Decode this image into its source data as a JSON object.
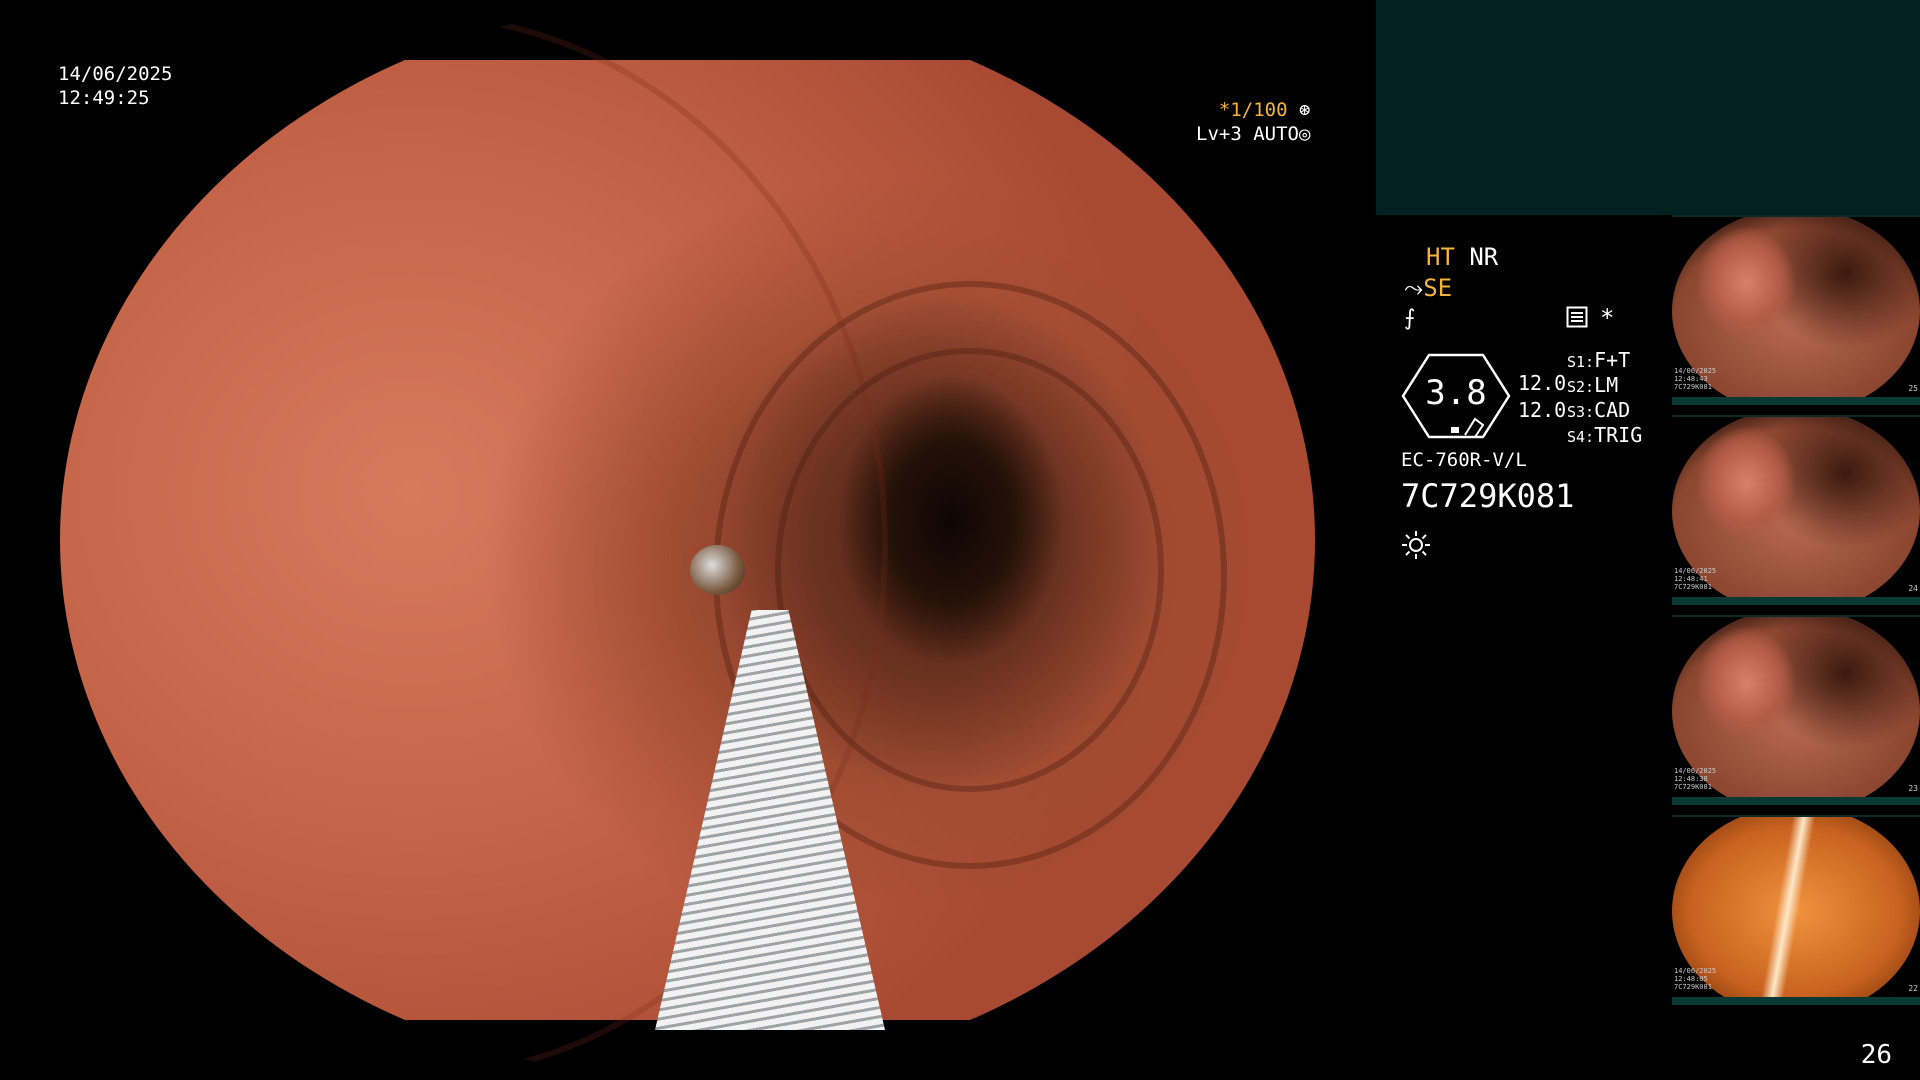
{
  "overlay": {
    "date": "14/06/2025",
    "time": "12:49:25",
    "shutter_speed": "*1/100",
    "level": "Lv+3",
    "mode": "AUTO"
  },
  "settings": {
    "ht": "HT",
    "nr": "NR",
    "se": "SE",
    "gauge_value": "3.8",
    "gauge_right_1": "12.0",
    "gauge_right_2": "12.0",
    "switches": [
      {
        "key": "S1:",
        "value": "F+T"
      },
      {
        "key": "S2:",
        "value": "LM"
      },
      {
        "key": "S3:",
        "value": "CAD"
      },
      {
        "key": "S4:",
        "value": "TRIG"
      }
    ],
    "star": "*",
    "scope_model": "EC-760R-V/L",
    "scope_serial": "7C729K081"
  },
  "thumbnails": [
    {
      "date": "14/06/2025",
      "time": "12:48:43",
      "serial": "7C729K081",
      "index": "25"
    },
    {
      "date": "14/06/2025",
      "time": "12:48:41",
      "serial": "7C729K081",
      "index": "24"
    },
    {
      "date": "14/06/2025",
      "time": "12:48:38",
      "serial": "7C729K081",
      "index": "23"
    },
    {
      "date": "14/06/2025",
      "time": "12:48:05",
      "serial": "7C729K081",
      "index": "22"
    }
  ],
  "page_number": "26",
  "colors": {
    "accent": "#f4b43a",
    "panel": "#032120"
  }
}
